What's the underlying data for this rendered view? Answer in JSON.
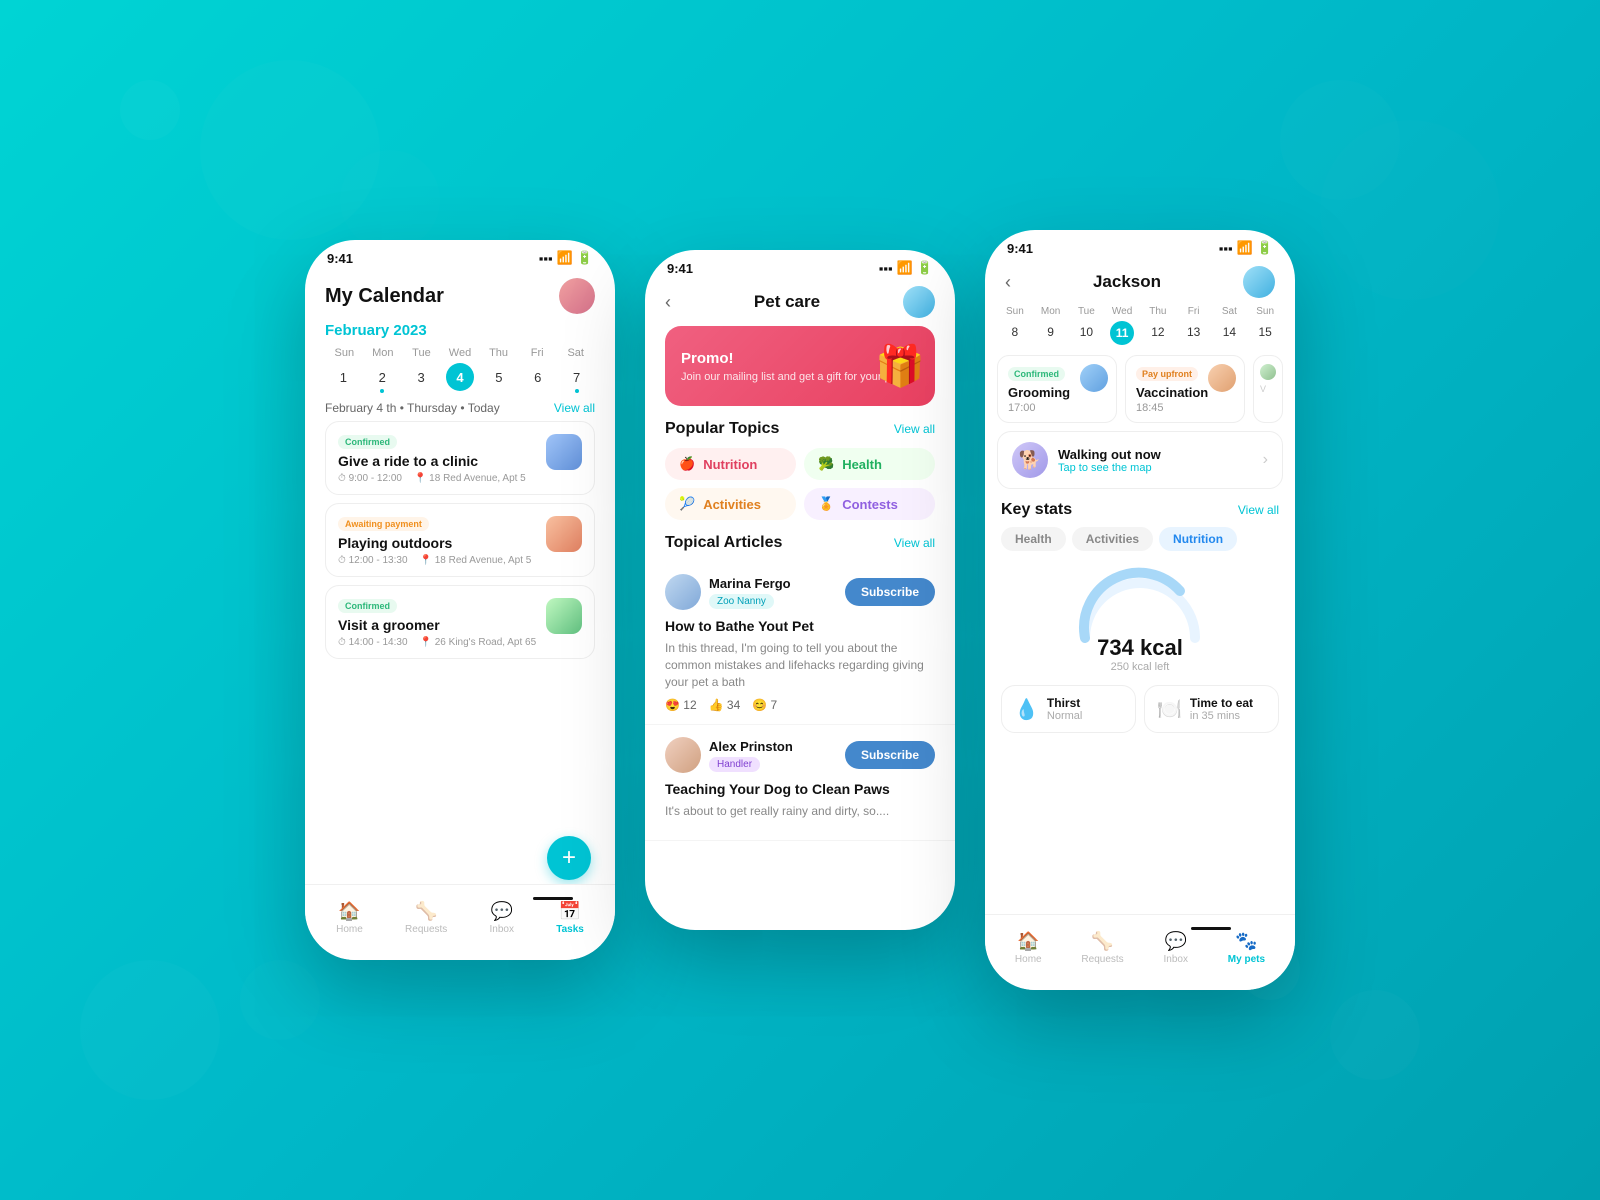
{
  "app": {
    "time": "9:41",
    "background_color": "#00c8d8"
  },
  "left_phone": {
    "title": "My Calendar",
    "month": "February 2023",
    "calendar": {
      "headers": [
        "Sun",
        "Mon",
        "Tue",
        "Wed",
        "Thu",
        "Fri",
        "Sat"
      ],
      "days": [
        "1",
        "2",
        "3",
        "4",
        "5",
        "6",
        "7"
      ],
      "active_day": "4"
    },
    "date_line": "February 4 th • Thursday • Today",
    "view_all": "View all",
    "events": [
      {
        "badge": "Confirmed",
        "badge_type": "confirmed",
        "title": "Give a ride to a clinic",
        "time": "9:00 - 12:00",
        "address": "18 Red Avenue, Apt 5"
      },
      {
        "badge": "Awaiting payment",
        "badge_type": "awaiting",
        "title": "Playing outdoors",
        "time": "12:00 - 13:30",
        "address": "18 Red Avenue, Apt 5"
      },
      {
        "badge": "Confirmed",
        "badge_type": "confirmed",
        "title": "Visit a groomer",
        "time": "14:00 - 14:30",
        "address": "26 King's Road, Apt 65"
      }
    ],
    "fab_label": "+",
    "nav": [
      {
        "label": "Home",
        "icon": "🏠",
        "active": false
      },
      {
        "label": "Requests",
        "icon": "🦴",
        "active": false
      },
      {
        "label": "Inbox",
        "icon": "💬",
        "active": false
      },
      {
        "label": "Tasks",
        "icon": "📅",
        "active": true
      }
    ]
  },
  "center_phone": {
    "title": "Pet care",
    "promo": {
      "title": "Promo!",
      "subtitle": "Join our mailing list and get a gift for your pet",
      "icon": "🎁"
    },
    "popular_topics": {
      "label": "Popular Topics",
      "view_all": "View all",
      "topics": [
        {
          "name": "Nutrition",
          "icon": "🍎",
          "style": "nutrition"
        },
        {
          "name": "Health",
          "icon": "🥦",
          "style": "health"
        },
        {
          "name": "Activities",
          "icon": "🎾",
          "style": "activities"
        },
        {
          "name": "Contests",
          "icon": "🏅",
          "style": "contests"
        }
      ]
    },
    "topical_articles": {
      "label": "Topical Articles",
      "view_all": "View all",
      "articles": [
        {
          "author_name": "Marina Fergo",
          "author_role": "Zoo Nanny",
          "role_style": "nanny",
          "title": "How to Bathe Yout Pet",
          "excerpt": "In this thread, I'm going to tell you about the common mistakes and lifehacks regarding giving your pet a bath",
          "reactions": [
            {
              "icon": "😍",
              "count": "12"
            },
            {
              "icon": "👍",
              "count": "34"
            },
            {
              "icon": "😊",
              "count": "7"
            }
          ],
          "subscribe_label": "Subscribe"
        },
        {
          "author_name": "Alex Prinston",
          "author_role": "Handler",
          "role_style": "handler",
          "title": "Teaching Your Dog to Clean Paws",
          "excerpt": "It's about to get really rainy and dirty, so....",
          "reactions": [],
          "subscribe_label": "Subscribe"
        }
      ]
    }
  },
  "right_phone": {
    "pet_name": "Jackson",
    "calendar": {
      "headers": [
        "Sun",
        "Mon",
        "Tue",
        "Wed",
        "Thu",
        "Fri",
        "Sat",
        "Sun"
      ],
      "days": [
        "8",
        "9",
        "10",
        "11",
        "12",
        "13",
        "14",
        "15"
      ],
      "active_day": "11"
    },
    "appointments": [
      {
        "badge": "Confirmed",
        "badge_type": "confirmed",
        "title": "Grooming",
        "time": "17:00"
      },
      {
        "badge": "Pay upfront",
        "badge_type": "payupfront",
        "title": "Vaccination",
        "time": "18:45"
      }
    ],
    "walking": {
      "title": "Walking out now",
      "subtitle": "Tap to see the map",
      "icon": "🐕"
    },
    "key_stats": {
      "label": "Key stats",
      "view_all": "View all",
      "tabs": [
        {
          "label": "Health",
          "active": false
        },
        {
          "label": "Activities",
          "active": false
        },
        {
          "label": "Nutrition",
          "active": true
        }
      ],
      "gauge": {
        "value": "734 kcal",
        "sub": "250 kcal left",
        "arc_percent": 75
      },
      "stats": [
        {
          "icon": "💧",
          "label": "Thirst",
          "value": "Normal"
        },
        {
          "icon": "🍽️",
          "label": "Time to eat",
          "value": "in 35 mins"
        }
      ]
    },
    "nav": [
      {
        "label": "Home",
        "icon": "🏠",
        "active": false
      },
      {
        "label": "Requests",
        "icon": "🦴",
        "active": false
      },
      {
        "label": "Inbox",
        "icon": "💬",
        "active": false
      },
      {
        "label": "My pets",
        "icon": "🐾",
        "active": true
      }
    ]
  }
}
